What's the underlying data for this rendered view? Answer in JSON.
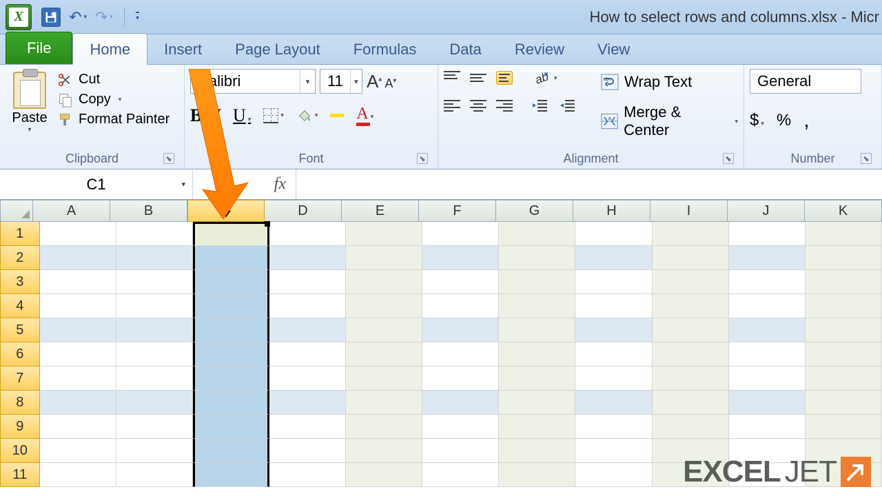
{
  "title": "How to select rows and columns.xlsx - Micr",
  "tabs": {
    "file": "File",
    "home": "Home",
    "insert": "Insert",
    "page_layout": "Page Layout",
    "formulas": "Formulas",
    "data": "Data",
    "review": "Review",
    "view": "View"
  },
  "clipboard": {
    "paste": "Paste",
    "cut": "Cut",
    "copy": "Copy",
    "format_painter": "Format Painter",
    "group_label": "Clipboard"
  },
  "font": {
    "name": "Calibri",
    "size": "11",
    "group_label": "Font"
  },
  "alignment": {
    "wrap": "Wrap Text",
    "merge": "Merge & Center",
    "group_label": "Alignment"
  },
  "number": {
    "format": "General",
    "group_label": "Number",
    "dollar": "$",
    "percent": "%",
    "comma": ","
  },
  "namebox": "C1",
  "columns": [
    "A",
    "B",
    "C",
    "D",
    "E",
    "F",
    "G",
    "H",
    "I",
    "J",
    "K"
  ],
  "rows": [
    1,
    2,
    3,
    4,
    5,
    6,
    7,
    8,
    9,
    10,
    11
  ],
  "selected_column_index": 2,
  "banded_columns": [
    4,
    6,
    8,
    10
  ],
  "alt_band_rows": [
    1,
    4,
    7
  ],
  "logo": {
    "text1": "EXCEL",
    "text2": "JET"
  }
}
